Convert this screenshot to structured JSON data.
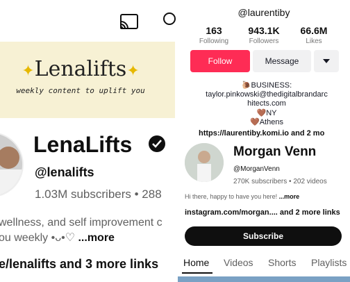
{
  "left": {
    "banner": {
      "title": "Lenalifts",
      "subtitle": "weekly content to uplift you"
    },
    "channel_name": "LenaLifts",
    "handle": "@lenalifts",
    "stats_line": "1.03M subscribers • 288",
    "description_line1": "wellness, and self improvement c",
    "description_line2": "ou weekly •ᴗ•♡ ",
    "more_label": "...more",
    "links_line": "e/lenalifts and 3 more links"
  },
  "right": {
    "header_handle": "@laurentiby",
    "stats": [
      {
        "value": "163",
        "label": "Following"
      },
      {
        "value": "943.1K",
        "label": "Followers"
      },
      {
        "value": "66.6M",
        "label": "Likes"
      }
    ],
    "follow_label": "Follow",
    "message_label": "Message",
    "bio": {
      "line1": "🐌BUSINESS:",
      "line2": "taylor.pinkowski@thedigitalbrandarc",
      "line3": "hitects.com",
      "line4": "🤎NY",
      "line5": "🤎Athens"
    },
    "link_line": "https://laurentiby.komi.io and 2 mo",
    "channel": {
      "name": "Morgan Venn",
      "handle": "@MorganVenn",
      "stats": "270K subscribers • 202 videos",
      "description": "Hi there, happy to have you here! ",
      "more_label": "...more",
      "links": "instagram.com/morgan.... and 2 more links",
      "subscribe_label": "Subscribe"
    },
    "tabs": [
      "Home",
      "Videos",
      "Shorts",
      "Playlists"
    ]
  },
  "colors": {
    "tiktok_red": "#fe2c55",
    "yt_black": "#0f0f0f",
    "banner_bg": "#f7f1d4"
  }
}
